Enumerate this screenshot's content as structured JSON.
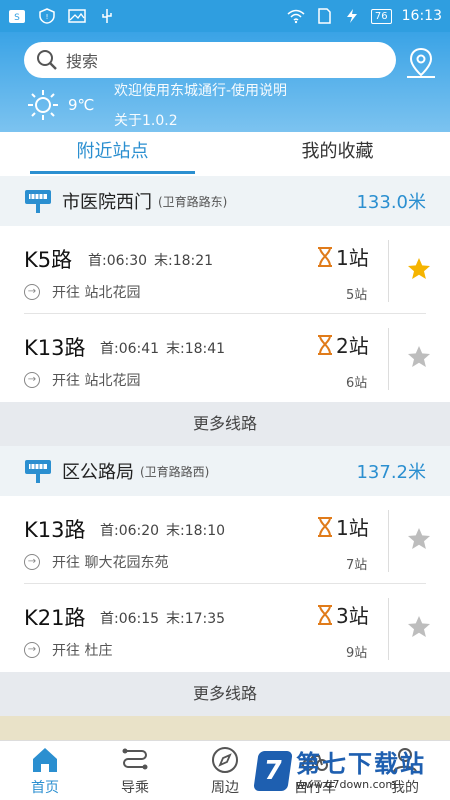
{
  "status": {
    "battery": "76",
    "time": "16:13"
  },
  "search": {
    "placeholder": "搜索"
  },
  "weather": {
    "temp": "9℃"
  },
  "notice": {
    "line1": "欢迎使用东城通行-使用说明",
    "line2": "关于1.0.2"
  },
  "tabs": [
    {
      "label": "附近站点"
    },
    {
      "label": "我的收藏"
    }
  ],
  "stations": [
    {
      "name": "市医院西门",
      "sub": "(卫育路路东)",
      "dist": "133.0米",
      "routes": [
        {
          "name": "K5路",
          "first": "首:06:30",
          "last": "末:18:21",
          "dest": "开往 站北花园",
          "stops": "1站",
          "count": "5站",
          "fav": true
        },
        {
          "name": "K13路",
          "first": "首:06:41",
          "last": "末:18:41",
          "dest": "开往 站北花园",
          "stops": "2站",
          "count": "6站",
          "fav": false
        }
      ],
      "more": "更多线路"
    },
    {
      "name": "区公路局",
      "sub": "(卫育路路西)",
      "dist": "137.2米",
      "routes": [
        {
          "name": "K13路",
          "first": "首:06:20",
          "last": "末:18:10",
          "dest": "开往 聊大花园东苑",
          "stops": "1站",
          "count": "7站",
          "fav": false
        },
        {
          "name": "K21路",
          "first": "首:06:15",
          "last": "末:17:35",
          "dest": "开往 杜庄",
          "stops": "3站",
          "count": "9站",
          "fav": false
        }
      ],
      "more": "更多线路"
    }
  ],
  "nav": [
    {
      "label": "首页",
      "icon": "home-icon"
    },
    {
      "label": "导乘",
      "icon": "route-icon"
    },
    {
      "label": "周边",
      "icon": "compass-icon"
    },
    {
      "label": "自行车",
      "icon": "bike-icon"
    },
    {
      "label": "我的",
      "icon": "user-icon"
    }
  ],
  "watermark": {
    "text": "第七下载站",
    "url": "www.d7down.com",
    "logo": "7"
  },
  "colors": {
    "accent": "#2b8fd0",
    "star_on": "#f5b400",
    "star_off": "#bdbdbd",
    "hourglass": "#e07b1a"
  }
}
